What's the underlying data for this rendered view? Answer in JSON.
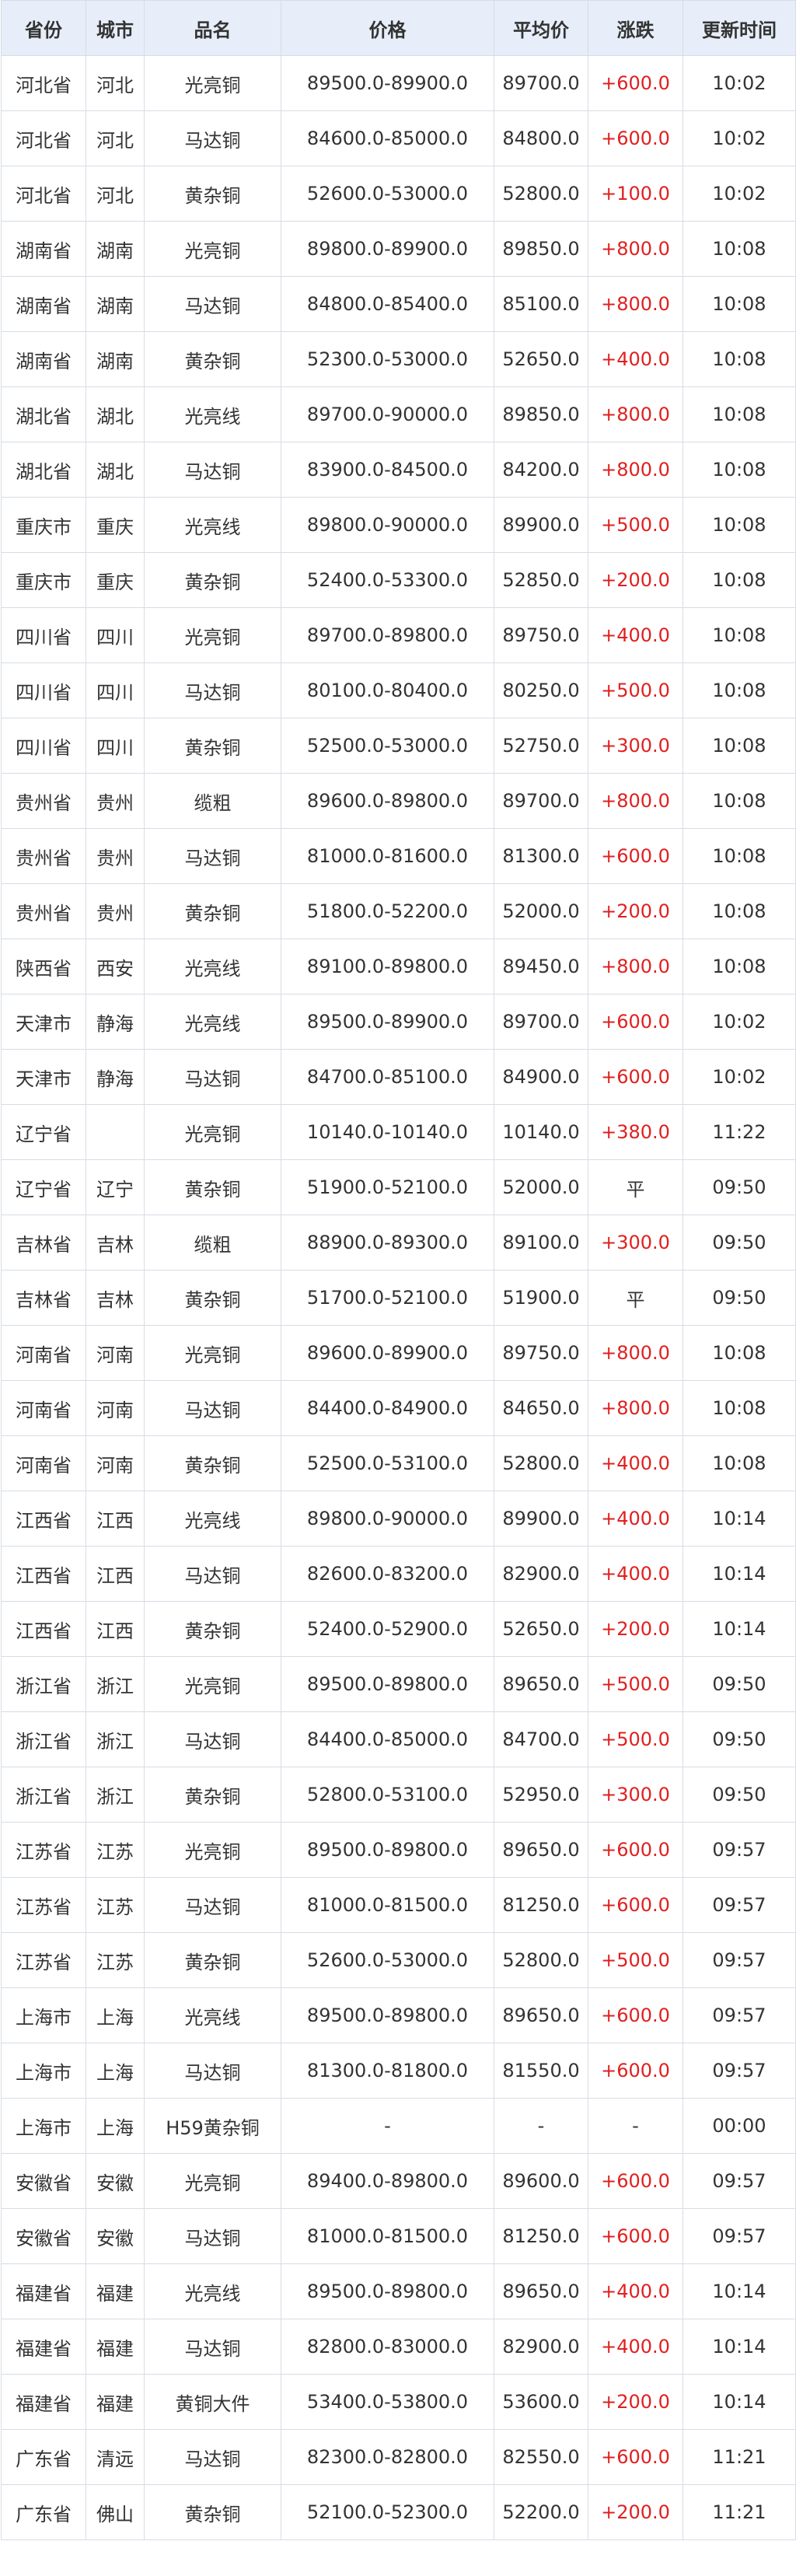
{
  "table": {
    "headers": [
      "省份",
      "城市",
      "品名",
      "价格",
      "平均价",
      "涨跌",
      "更新时间"
    ],
    "rows": [
      [
        "河北省",
        "河北",
        "光亮铜",
        "89500.0-89900.0",
        "89700.0",
        "+600.0",
        "10:02"
      ],
      [
        "河北省",
        "河北",
        "马达铜",
        "84600.0-85000.0",
        "84800.0",
        "+600.0",
        "10:02"
      ],
      [
        "河北省",
        "河北",
        "黄杂铜",
        "52600.0-53000.0",
        "52800.0",
        "+100.0",
        "10:02"
      ],
      [
        "湖南省",
        "湖南",
        "光亮铜",
        "89800.0-89900.0",
        "89850.0",
        "+800.0",
        "10:08"
      ],
      [
        "湖南省",
        "湖南",
        "马达铜",
        "84800.0-85400.0",
        "85100.0",
        "+800.0",
        "10:08"
      ],
      [
        "湖南省",
        "湖南",
        "黄杂铜",
        "52300.0-53000.0",
        "52650.0",
        "+400.0",
        "10:08"
      ],
      [
        "湖北省",
        "湖北",
        "光亮线",
        "89700.0-90000.0",
        "89850.0",
        "+800.0",
        "10:08"
      ],
      [
        "湖北省",
        "湖北",
        "马达铜",
        "83900.0-84500.0",
        "84200.0",
        "+800.0",
        "10:08"
      ],
      [
        "重庆市",
        "重庆",
        "光亮线",
        "89800.0-90000.0",
        "89900.0",
        "+500.0",
        "10:08"
      ],
      [
        "重庆市",
        "重庆",
        "黄杂铜",
        "52400.0-53300.0",
        "52850.0",
        "+200.0",
        "10:08"
      ],
      [
        "四川省",
        "四川",
        "光亮铜",
        "89700.0-89800.0",
        "89750.0",
        "+400.0",
        "10:08"
      ],
      [
        "四川省",
        "四川",
        "马达铜",
        "80100.0-80400.0",
        "80250.0",
        "+500.0",
        "10:08"
      ],
      [
        "四川省",
        "四川",
        "黄杂铜",
        "52500.0-53000.0",
        "52750.0",
        "+300.0",
        "10:08"
      ],
      [
        "贵州省",
        "贵州",
        "缆粗",
        "89600.0-89800.0",
        "89700.0",
        "+800.0",
        "10:08"
      ],
      [
        "贵州省",
        "贵州",
        "马达铜",
        "81000.0-81600.0",
        "81300.0",
        "+600.0",
        "10:08"
      ],
      [
        "贵州省",
        "贵州",
        "黄杂铜",
        "51800.0-52200.0",
        "52000.0",
        "+200.0",
        "10:08"
      ],
      [
        "陕西省",
        "西安",
        "光亮线",
        "89100.0-89800.0",
        "89450.0",
        "+800.0",
        "10:08"
      ],
      [
        "天津市",
        "静海",
        "光亮线",
        "89500.0-89900.0",
        "89700.0",
        "+600.0",
        "10:02"
      ],
      [
        "天津市",
        "静海",
        "马达铜",
        "84700.0-85100.0",
        "84900.0",
        "+600.0",
        "10:02"
      ],
      [
        "辽宁省",
        "",
        "光亮铜",
        "10140.0-10140.0",
        "10140.0",
        "+380.0",
        "11:22"
      ],
      [
        "辽宁省",
        "辽宁",
        "黄杂铜",
        "51900.0-52100.0",
        "52000.0",
        "平",
        "09:50"
      ],
      [
        "吉林省",
        "吉林",
        "缆粗",
        "88900.0-89300.0",
        "89100.0",
        "+300.0",
        "09:50"
      ],
      [
        "吉林省",
        "吉林",
        "黄杂铜",
        "51700.0-52100.0",
        "51900.0",
        "平",
        "09:50"
      ],
      [
        "河南省",
        "河南",
        "光亮铜",
        "89600.0-89900.0",
        "89750.0",
        "+800.0",
        "10:08"
      ],
      [
        "河南省",
        "河南",
        "马达铜",
        "84400.0-84900.0",
        "84650.0",
        "+800.0",
        "10:08"
      ],
      [
        "河南省",
        "河南",
        "黄杂铜",
        "52500.0-53100.0",
        "52800.0",
        "+400.0",
        "10:08"
      ],
      [
        "江西省",
        "江西",
        "光亮线",
        "89800.0-90000.0",
        "89900.0",
        "+400.0",
        "10:14"
      ],
      [
        "江西省",
        "江西",
        "马达铜",
        "82600.0-83200.0",
        "82900.0",
        "+400.0",
        "10:14"
      ],
      [
        "江西省",
        "江西",
        "黄杂铜",
        "52400.0-52900.0",
        "52650.0",
        "+200.0",
        "10:14"
      ],
      [
        "浙江省",
        "浙江",
        "光亮铜",
        "89500.0-89800.0",
        "89650.0",
        "+500.0",
        "09:50"
      ],
      [
        "浙江省",
        "浙江",
        "马达铜",
        "84400.0-85000.0",
        "84700.0",
        "+500.0",
        "09:50"
      ],
      [
        "浙江省",
        "浙江",
        "黄杂铜",
        "52800.0-53100.0",
        "52950.0",
        "+300.0",
        "09:50"
      ],
      [
        "江苏省",
        "江苏",
        "光亮铜",
        "89500.0-89800.0",
        "89650.0",
        "+600.0",
        "09:57"
      ],
      [
        "江苏省",
        "江苏",
        "马达铜",
        "81000.0-81500.0",
        "81250.0",
        "+600.0",
        "09:57"
      ],
      [
        "江苏省",
        "江苏",
        "黄杂铜",
        "52600.0-53000.0",
        "52800.0",
        "+500.0",
        "09:57"
      ],
      [
        "上海市",
        "上海",
        "光亮线",
        "89500.0-89800.0",
        "89650.0",
        "+600.0",
        "09:57"
      ],
      [
        "上海市",
        "上海",
        "马达铜",
        "81300.0-81800.0",
        "81550.0",
        "+600.0",
        "09:57"
      ],
      [
        "上海市",
        "上海",
        "H59黄杂铜",
        "-",
        "-",
        "-",
        "00:00"
      ],
      [
        "安徽省",
        "安徽",
        "光亮铜",
        "89400.0-89800.0",
        "89600.0",
        "+600.0",
        "09:57"
      ],
      [
        "安徽省",
        "安徽",
        "马达铜",
        "81000.0-81500.0",
        "81250.0",
        "+600.0",
        "09:57"
      ],
      [
        "福建省",
        "福建",
        "光亮线",
        "89500.0-89800.0",
        "89650.0",
        "+400.0",
        "10:14"
      ],
      [
        "福建省",
        "福建",
        "马达铜",
        "82800.0-83000.0",
        "82900.0",
        "+400.0",
        "10:14"
      ],
      [
        "福建省",
        "福建",
        "黄铜大件",
        "53400.0-53800.0",
        "53600.0",
        "+200.0",
        "10:14"
      ],
      [
        "广东省",
        "清远",
        "马达铜",
        "82300.0-82800.0",
        "82550.0",
        "+600.0",
        "11:21"
      ],
      [
        "广东省",
        "佛山",
        "黄杂铜",
        "52100.0-52300.0",
        "52200.0",
        "+200.0",
        "11:21"
      ]
    ]
  },
  "colors": {
    "header_bg": "#e7eef9",
    "border": "#d7dce4",
    "text": "#333333",
    "rise": "#e02020"
  }
}
